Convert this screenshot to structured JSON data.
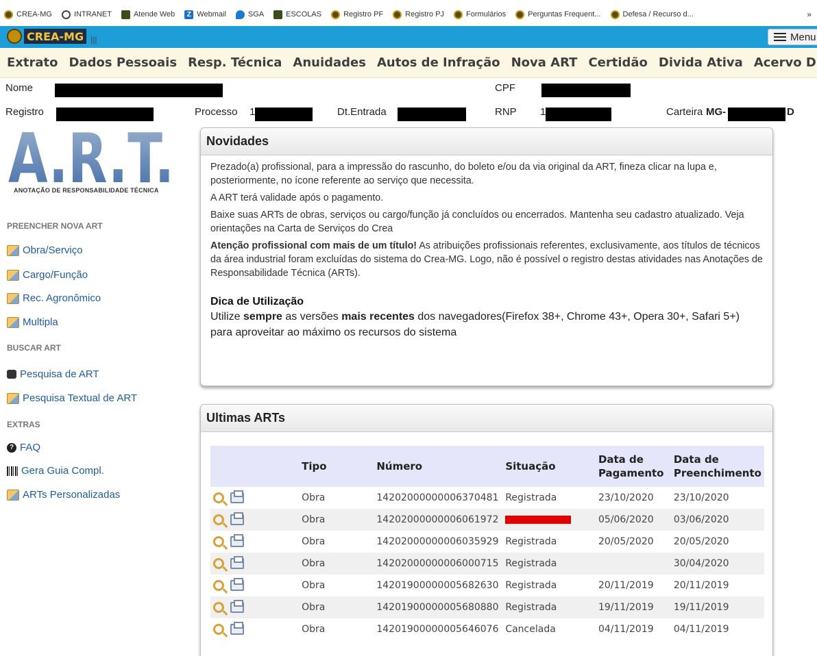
{
  "browser": {
    "bookmarks": [
      {
        "label": "CREA-MG",
        "icon": "crea-icon"
      },
      {
        "label": "INTRANET",
        "icon": "globe-icon"
      },
      {
        "label": "Atende Web",
        "icon": "app-icon"
      },
      {
        "label": "Webmail",
        "icon": "zimbra-icon"
      },
      {
        "label": "SGA",
        "icon": "sga-icon"
      },
      {
        "label": "ESCOLAS",
        "icon": "app-icon"
      },
      {
        "label": "Registro PF",
        "icon": "crea-icon"
      },
      {
        "label": "Registro PJ",
        "icon": "crea-icon"
      },
      {
        "label": "Formulários",
        "icon": "crea-icon"
      },
      {
        "label": "Perguntas Frequent...",
        "icon": "crea-icon"
      },
      {
        "label": "Defesa / Recurso d...",
        "icon": "crea-icon"
      }
    ],
    "more": "»"
  },
  "header": {
    "logo_text": "CREA-MG",
    "menu_label": "Menu",
    "accent": "#1d9ed9"
  },
  "nav": [
    "Extrato",
    "Dados Pessoais",
    "Resp. Técnica",
    "Anuidades",
    "Autos de Infração",
    "Nova ART",
    "Certidão",
    "Divida Ativa",
    "Acervo Digital"
  ],
  "info": {
    "nome_label": "Nome",
    "cpf_label": "CPF",
    "registro_label": "Registro",
    "processo_label": "Processo",
    "processo_prefix": "1",
    "dt_entrada_label": "Dt.Entrada",
    "rnp_label": "RNP",
    "rnp_prefix": "1",
    "carteira_label": "Carteira",
    "carteira_prefix": "MG-",
    "carteira_suffix": "D"
  },
  "sidebar": {
    "logo_text": "A.R.T.",
    "logo_subtitle": "ANOTAÇÃO DE RESPONSABILIDADE TÉCNICA",
    "sections": [
      {
        "heading": "PREENCHER NOVA ART",
        "items": [
          "Obra/Serviço",
          "Cargo/Função",
          "Rec. Agronômico",
          "Multipla"
        ]
      },
      {
        "heading": "BUSCAR ART",
        "items": [
          "Pesquisa de ART",
          "Pesquisa Textual de ART"
        ]
      },
      {
        "heading": "EXTRAS",
        "items": [
          "FAQ",
          "Gera Guia Compl.",
          "ARTs Personalizadas"
        ]
      }
    ]
  },
  "novidades": {
    "title": "Novidades",
    "p1": "Prezado(a) profissional, para a impressão do rascunho, do boleto e/ou da via original da ART, fineza clicar na lupa e, posteriormente, no ícone referente ao serviço que necessita.",
    "p2": "A ART terá validade após o pagamento.",
    "p3": "Baixe suas ARTs de obras, serviços ou cargo/função já concluídos ou encerrados. Mantenha seu cadastro atualizado. Veja orientações na Carta de Serviços do Crea",
    "p4_bold": "Atenção profissional com mais de um título!",
    "p4_rest": " As atribuições profissionais referentes, exclusivamente, aos títulos de técnicos da área industrial foram excluídas do sistema do Crea-MG. Logo, não é possível o registro destas atividades nas Anotações de Responsabilidade Técnica (ARTs).",
    "dica_title": "Dica de Utilização",
    "dica_1": "Utilize ",
    "dica_2": "sempre",
    "dica_3": " as versões ",
    "dica_4": "mais recentes",
    "dica_5": " dos navegadores(Firefox 38+, Chrome 43+, Opera 30+, Safari 5+) para aproveitar ao máximo os recursos do sistema"
  },
  "ultimas": {
    "title": "Ultimas ARTs",
    "columns": [
      "Tipo",
      "Número",
      "Situação",
      "Data de Pagamento",
      "Data de Preenchimento"
    ],
    "col_pag_1": "Data de",
    "col_pag_2": "Pagamento",
    "col_pre_1": "Data de",
    "col_pre_2": "Preenchimento",
    "rows": [
      {
        "tipo": "Obra",
        "numero": "14202000000006370481",
        "situacao": "Registrada",
        "pagamento": "23/10/2020",
        "preenchimento": "23/10/2020"
      },
      {
        "tipo": "Obra",
        "numero": "14202000000006061972",
        "situacao": "",
        "pagamento": "05/06/2020",
        "preenchimento": "03/06/2020"
      },
      {
        "tipo": "Obra",
        "numero": "14202000000006035929",
        "situacao": "Registrada",
        "pagamento": "20/05/2020",
        "preenchimento": "20/05/2020"
      },
      {
        "tipo": "Obra",
        "numero": "14202000000006000715",
        "situacao": "Registrada",
        "pagamento": "",
        "preenchimento": "30/04/2020"
      },
      {
        "tipo": "Obra",
        "numero": "14201900000005682630",
        "situacao": "Registrada",
        "pagamento": "20/11/2019",
        "preenchimento": "20/11/2019"
      },
      {
        "tipo": "Obra",
        "numero": "14201900000005680880",
        "situacao": "Registrada",
        "pagamento": "19/11/2019",
        "preenchimento": "19/11/2019"
      },
      {
        "tipo": "Obra",
        "numero": "14201900000005646076",
        "situacao": "Cancelada",
        "pagamento": "04/11/2019",
        "preenchimento": "04/11/2019"
      }
    ]
  }
}
